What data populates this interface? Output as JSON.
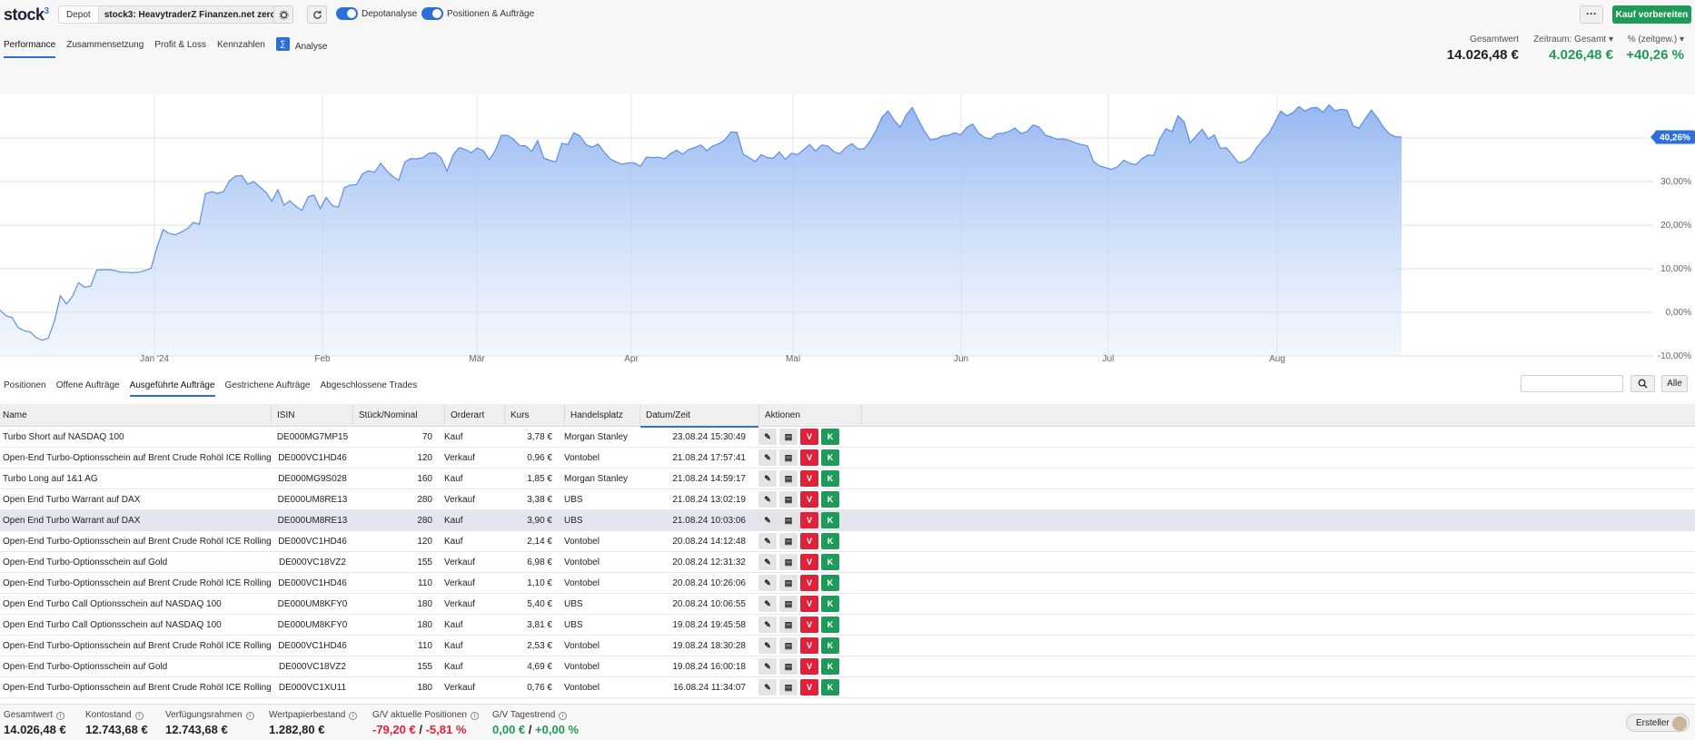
{
  "app": {
    "logo": "stock",
    "logo_sup": "3"
  },
  "header": {
    "depot_label": "Depot",
    "depot_value": "stock3: HeavytraderZ Finanzen.net zero",
    "toggle_depotanalyse": "Depotanalyse",
    "toggle_positionen": "Positionen & Aufträge",
    "more_label": "···",
    "buy_label": "Kauf vorbereiten"
  },
  "tabs_top": [
    "Performance",
    "Zusammensetzung",
    "Profit & Loss",
    "Kennzahlen",
    "Analyse"
  ],
  "kpis": {
    "gesamtwert_label": "Gesamtwert",
    "gesamtwert_value": "14.026,48 €",
    "zeitraum_label": "Zeitraum: Gesamt ▾",
    "zeitraum_value": "4.026,48 €",
    "pct_label": "% (zeitgew.) ▾",
    "pct_value": "+40,26 %"
  },
  "chart_data": {
    "type": "area",
    "x_ticks": [
      "Jan '24",
      "Feb",
      "Mär",
      "Apr",
      "Mai",
      "Jun",
      "Jul",
      "Aug"
    ],
    "y_ticks": [
      "-10,00%",
      "0,00%",
      "10,00%",
      "20,00%",
      "30,00%"
    ],
    "ylim": [
      -10,
      50
    ],
    "last_value_label": "40,26%",
    "color": "#5b8fe6",
    "values": [
      0.5,
      -0.8,
      -1.2,
      -3.5,
      -4.2,
      -4.5,
      -5.8,
      -6.4,
      -5.9,
      -2,
      3.8,
      1.9,
      3.7,
      6.8,
      5.8,
      6,
      9.7,
      9.8,
      9.8,
      9.6,
      9.2,
      9.2,
      9.1,
      9.2,
      9.6,
      10.1,
      15,
      19,
      18.1,
      17.8,
      18.4,
      19.2,
      20.6,
      20.2,
      27.2,
      27.7,
      27.3,
      27.7,
      30.2,
      31.3,
      31.4,
      29.4,
      30,
      28.8,
      27.6,
      25.5,
      28.1,
      24.6,
      25.6,
      24.3,
      23.4,
      26.5,
      26.9,
      23.8,
      26.4,
      24.5,
      24.1,
      28.6,
      29.2,
      29.3,
      31.8,
      32.5,
      32.1,
      34.2,
      32.5,
      31.2,
      30.3,
      34.5,
      35.3,
      35.2,
      35.5,
      36.5,
      36.6,
      35.5,
      32.4,
      36.1,
      37.8,
      37.4,
      36.6,
      37.7,
      37.1,
      35,
      37.2,
      40.6,
      40.6,
      39.7,
      38.3,
      38.2,
      36.9,
      39.4,
      35.4,
      34.9,
      34.5,
      38.8,
      38.5,
      41.2,
      40.5,
      38.5,
      37.9,
      38.6,
      36.8,
      35.2,
      34.5,
      34,
      34.3,
      34.3,
      33.5,
      35.6,
      35.5,
      35.6,
      35.2,
      36.4,
      37.2,
      36.3,
      37.4,
      37.8,
      38.4,
      37.1,
      38.2,
      38.7,
      39.6,
      41.4,
      41.3,
      36.3,
      35.5,
      34.6,
      36.2,
      35.5,
      35.4,
      36.8,
      35.1,
      36.5,
      36.2,
      37.3,
      38.5,
      37,
      38.4,
      38.2,
      36.9,
      36.4,
      37.8,
      38.7,
      37.5,
      37.5,
      39.2,
      41.7,
      44.8,
      46.2,
      44.1,
      42.5,
      45.3,
      47,
      44.2,
      41.6,
      39.6,
      39.8,
      40.5,
      40.6,
      41.2,
      40.7,
      42.4,
      43.2,
      41.1,
      40.1,
      39.8,
      41,
      41.1,
      41.5,
      42.3,
      41,
      41.5,
      43,
      42.5,
      40.7,
      40.2,
      39.7,
      39.8,
      39.5,
      38.9,
      38.5,
      38.2,
      34.6,
      33.6,
      33.2,
      32.8,
      33.4,
      34.9,
      34.2,
      33.9,
      35.2,
      36.1,
      36,
      39.9,
      42.1,
      41.5,
      45.1,
      43.7,
      38.9,
      40.5,
      42,
      39.8,
      40.7,
      37.6,
      37.8,
      36.1,
      34.3,
      34.6,
      35.6,
      37.8,
      39.5,
      41,
      43.5,
      46.2,
      45.1,
      45.8,
      47.2,
      46.2,
      46.9,
      47,
      45.9,
      47.6,
      46.3,
      46.6,
      46.4,
      42.7,
      42.3,
      44.5,
      46.4,
      44.6,
      42.5,
      40.9,
      40.3,
      40.2
    ]
  },
  "tabs_bottom": [
    "Positionen",
    "Offene Aufträge",
    "Ausgeführte Aufträge",
    "Gestrichene Aufträge",
    "Abgeschlossene Trades"
  ],
  "filter": {
    "search_placeholder": "",
    "all_label": "Alle"
  },
  "table": {
    "columns": [
      "Name",
      "ISIN",
      "Stück/Nominal",
      "Orderart",
      "Kurs",
      "Handelsplatz",
      "Datum/Zeit",
      "Aktionen"
    ],
    "rows": [
      {
        "name": "Turbo Short auf NASDAQ 100",
        "isin": "DE000MG7MP15",
        "qty": "70",
        "type": "Kauf",
        "kurs": "3,78 €",
        "hp": "Morgan Stanley",
        "dt": "23.08.24 15:30:49"
      },
      {
        "name": "Open-End Turbo-Optionsschein auf Brent Crude Rohöl ICE Rolling",
        "isin": "DE000VC1HD46",
        "qty": "120",
        "type": "Verkauf",
        "kurs": "0,96 €",
        "hp": "Vontobel",
        "dt": "21.08.24 17:57:41"
      },
      {
        "name": "Turbo Long auf 1&1 AG",
        "isin": "DE000MG9S028",
        "qty": "160",
        "type": "Kauf",
        "kurs": "1,85 €",
        "hp": "Morgan Stanley",
        "dt": "21.08.24 14:59:17"
      },
      {
        "name": "Open End Turbo Warrant auf DAX",
        "isin": "DE000UM8RE13",
        "qty": "280",
        "type": "Verkauf",
        "kurs": "3,38 €",
        "hp": "UBS",
        "dt": "21.08.24 13:02:19"
      },
      {
        "name": "Open End Turbo Warrant auf DAX",
        "isin": "DE000UM8RE13",
        "qty": "280",
        "type": "Kauf",
        "kurs": "3,90 €",
        "hp": "UBS",
        "dt": "21.08.24 10:03:06"
      },
      {
        "name": "Open-End Turbo-Optionsschein auf Brent Crude Rohöl ICE Rolling",
        "isin": "DE000VC1HD46",
        "qty": "120",
        "type": "Kauf",
        "kurs": "2,14 €",
        "hp": "Vontobel",
        "dt": "20.08.24 14:12:48"
      },
      {
        "name": "Open-End Turbo-Optionsschein auf Gold",
        "isin": "DE000VC18VZ2",
        "qty": "155",
        "type": "Verkauf",
        "kurs": "6,98 €",
        "hp": "Vontobel",
        "dt": "20.08.24 12:31:32"
      },
      {
        "name": "Open-End Turbo-Optionsschein auf Brent Crude Rohöl ICE Rolling",
        "isin": "DE000VC1HD46",
        "qty": "110",
        "type": "Verkauf",
        "kurs": "1,10 €",
        "hp": "Vontobel",
        "dt": "20.08.24 10:26:06"
      },
      {
        "name": "Open End Turbo Call Optionsschein auf NASDAQ 100",
        "isin": "DE000UM8KFY0",
        "qty": "180",
        "type": "Verkauf",
        "kurs": "5,40 €",
        "hp": "UBS",
        "dt": "20.08.24 10:06:55"
      },
      {
        "name": "Open End Turbo Call Optionsschein auf NASDAQ 100",
        "isin": "DE000UM8KFY0",
        "qty": "180",
        "type": "Kauf",
        "kurs": "3,81 €",
        "hp": "UBS",
        "dt": "19.08.24 19:45:58"
      },
      {
        "name": "Open-End Turbo-Optionsschein auf Brent Crude Rohöl ICE Rolling",
        "isin": "DE000VC1HD46",
        "qty": "110",
        "type": "Kauf",
        "kurs": "2,53 €",
        "hp": "Vontobel",
        "dt": "19.08.24 18:30:28"
      },
      {
        "name": "Open-End Turbo-Optionsschein auf Gold",
        "isin": "DE000VC18VZ2",
        "qty": "155",
        "type": "Kauf",
        "kurs": "4,69 €",
        "hp": "Vontobel",
        "dt": "19.08.24 16:00:18"
      },
      {
        "name": "Open-End Turbo-Optionsschein auf Brent Crude Rohöl ICE Rolling",
        "isin": "DE000VC1XU11",
        "qty": "180",
        "type": "Verkauf",
        "kurs": "0,76 €",
        "hp": "Vontobel",
        "dt": "16.08.24 11:34:07"
      }
    ],
    "action_labels": {
      "edit": "✎",
      "detail": "▤",
      "sell": "V",
      "buy": "K"
    }
  },
  "footer": {
    "gesamtwert_label": "Gesamtwert",
    "gesamtwert_value": "14.026,48 €",
    "kontostand_label": "Kontostand",
    "kontostand_value": "12.743,68 €",
    "verfuegung_label": "Verfügungsrahmen",
    "verfuegung_value": "12.743,68 €",
    "wertpapier_label": "Wertpapierbestand",
    "wertpapier_value": "1.282,80 €",
    "gv_akt_label": "G/V aktuelle Positionen",
    "gv_akt_abs": "-79,20 €",
    "gv_akt_sep": "/",
    "gv_akt_pct": "-5,81 %",
    "gv_tag_label": "G/V Tagestrend",
    "gv_tag_abs": "0,00 €",
    "gv_tag_sep": "/",
    "gv_tag_pct": "+0,00 %",
    "creator_label": "Ersteller"
  }
}
